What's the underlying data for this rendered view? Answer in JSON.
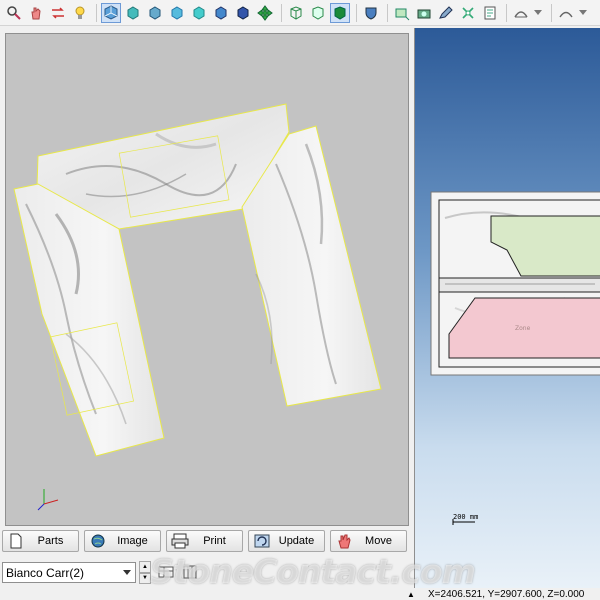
{
  "toolbar": {
    "icons": [
      "zoom-icon",
      "hand-icon",
      "swap-icon",
      "light-bulb-icon",
      "view-iso-icon",
      "view-front-icon",
      "view-back-icon",
      "view-left-icon",
      "view-right-icon",
      "view-top-icon",
      "view-bottom-icon",
      "pan-cross-icon",
      "wireframe-icon",
      "hidden-line-icon",
      "shaded-icon",
      "shield-icon",
      "rect-select-icon",
      "camera-icon",
      "edit-icon",
      "transform-icon",
      "report-icon",
      "arc-tool-icon",
      "curve-tool-icon"
    ]
  },
  "buttons": [
    {
      "label": "Parts",
      "icon": "document-icon"
    },
    {
      "label": "Image",
      "icon": "globe-icon"
    },
    {
      "label": "Print",
      "icon": "printer-icon"
    },
    {
      "label": "Update",
      "icon": "refresh-icon"
    },
    {
      "label": "Move",
      "icon": "hand-move-icon"
    }
  ],
  "material": {
    "value": "Bianco Carr(2)"
  },
  "scale": {
    "label": "200 mm"
  },
  "status": {
    "coordinates": "X=2406.521, Y=2907.600, Z=0.000"
  },
  "watermark": {
    "text": "StoneContact.com"
  },
  "colors": {
    "viewport_bg": "#c3c3c3",
    "outline": "#e8e84a",
    "accent_blue": "#2c5a98"
  }
}
